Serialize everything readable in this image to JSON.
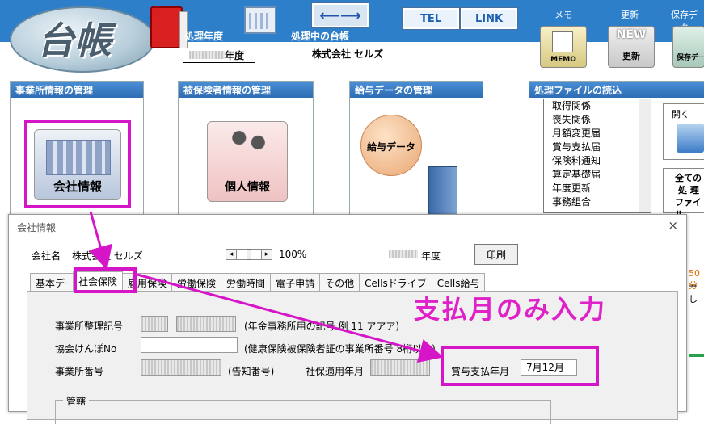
{
  "header": {
    "logo_text": "台帳",
    "processing_year_label": "処理年度",
    "current_ledger_label": "処理中の台帳",
    "year_suffix": "年度",
    "company_name": "株式会社 セルズ",
    "arrow_glyph": "⟵⟶",
    "tel_label": "TEL",
    "link_label": "LINK",
    "memo_label": "メモ",
    "update_label": "更新",
    "save_label": "保存データ",
    "memo_tile": "MEMO",
    "update_tile_top": "NEW",
    "update_tile": "更新",
    "save_tile": "保存デー"
  },
  "panels": {
    "office": {
      "title": "事業所情報の管理",
      "icon_label": "会社情報"
    },
    "insured": {
      "title": "被保険者情報の管理",
      "icon_label": "個人情報"
    },
    "salary": {
      "title": "給与データの管理",
      "icon_label": "給与データ"
    },
    "files": {
      "title": "処理ファイルの読込",
      "items": [
        "取得関係",
        "喪失関係",
        "月額変更届",
        "賞与支払届",
        "保険料通知",
        "算定基礎届",
        "年度更新",
        "事務組合"
      ],
      "open_label": "開く",
      "all_label_1": "全ての",
      "all_label_2": "処 理",
      "all_label_3": "ファイル"
    }
  },
  "dialog": {
    "title": "会社情報",
    "close": "×",
    "company_label": "会社名",
    "company_value": "株式会社 セルズ",
    "zoom": "100%",
    "year_suffix": "年度",
    "print_button": "印刷",
    "tabs": [
      "基本データ",
      "社会保険",
      "雇用保険",
      "労働保険",
      "労働時間",
      "電子申請",
      "その他",
      "Cellsドライブ",
      "Cells給与"
    ],
    "active_tab": "社会保険",
    "fields": {
      "office_code_label": "事業所整理記号",
      "office_code_hint": "(年金事務所用の記号 例 11 アアア)",
      "kyokai_label": "協会けんぽNo",
      "kyokai_hint": "(健康保険被保険者証の事業所番号 8桁以内)",
      "office_no_label": "事業所番号",
      "office_no_hint": "(告知番号)",
      "shaho_label": "社保適用年月",
      "bonus_label": "賞与支払年月",
      "bonus_value": "7月12月"
    },
    "group_label": "管轄"
  },
  "annotation": {
    "text": "支払月のみ入力",
    "color": "#e020c8"
  },
  "side_peek": {
    "line1": "50分",
    "line2": "ーし"
  }
}
